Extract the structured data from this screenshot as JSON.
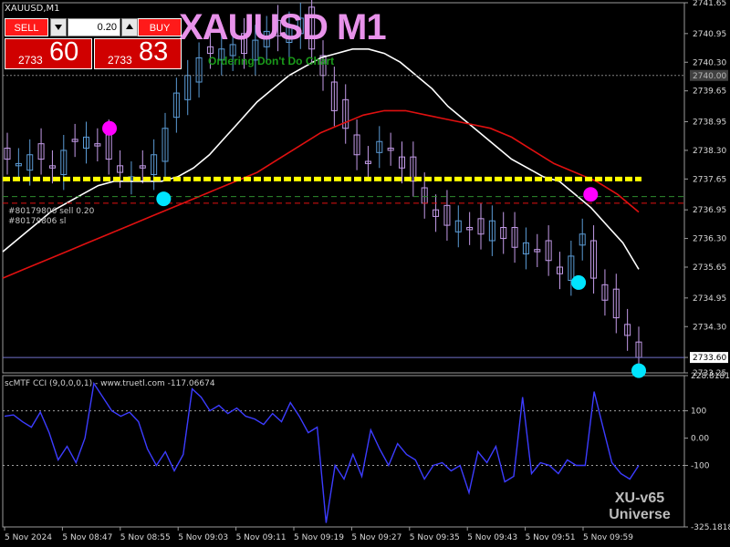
{
  "chart": {
    "symbol_title": "XAUUSD,M1",
    "watermark": "XAUUSD M1",
    "watermark_sub": "Ordering Don't Do Chart",
    "order_labels": [
      "#80179806 sell 0.20",
      "#80179806 sl"
    ],
    "indicator_title": "scMTF CCI (9,0,0,0,1) - www.truetl.com -117.06674",
    "brand_line1": "XU-v65",
    "brand_line2": "Universe"
  },
  "trade_panel": {
    "sell_label": "SELL",
    "buy_label": "BUY",
    "lot_value": "0.20",
    "sell_price_small": "2733",
    "sell_price_big": "60",
    "buy_price_small": "2733",
    "buy_price_big": "83"
  },
  "colors": {
    "background": "#000000",
    "bull_candle": "#5b9bd5",
    "bear_candle": "#c39be8",
    "ma_fast": "#ffffff",
    "ma_slow": "#e01010",
    "support_line": "#ffff00",
    "cci_line": "#3c3cff",
    "marker_buy": "#00e5ff",
    "marker_sell": "#ff00ff",
    "stop_line": "#e01010",
    "order_line": "#2e8b2e",
    "grid_dot": "#808080"
  },
  "chart_data": [
    {
      "type": "candlestick",
      "title": "XAUUSD,M1",
      "ylim": [
        2733.25,
        2741.65
      ],
      "y_ticks": [
        "2741.65",
        "2740.95",
        "2740.30",
        "2739.65",
        "2738.95",
        "2738.30",
        "2737.65",
        "2736.95",
        "2736.30",
        "2735.65",
        "2734.95",
        "2734.30",
        "2733.60",
        "2733.25"
      ],
      "price_labels": {
        "bid": "2733.60",
        "level": "2740.00"
      },
      "x_ticks": [
        "5 Nov 2024",
        "5 Nov 08:47",
        "5 Nov 08:55",
        "5 Nov 09:03",
        "5 Nov 09:11",
        "5 Nov 09:19",
        "5 Nov 09:27",
        "5 Nov 09:35",
        "5 Nov 09:43",
        "5 Nov 09:51",
        "5 Nov 09:59"
      ],
      "levels": {
        "support": 2737.65,
        "order": 2737.25,
        "stop": 2737.1,
        "bid": 2733.6,
        "top_dotted": 2740.0
      },
      "series": {
        "close_trend": [
          2738.1,
          2738.0,
          2738.2,
          2738.1,
          2737.9,
          2738.3,
          2738.5,
          2738.6,
          2738.4,
          2738.1,
          2737.8,
          2737.7,
          2737.9,
          2738.2,
          2738.8,
          2739.6,
          2740.0,
          2740.4,
          2740.5,
          2740.6,
          2740.7,
          2740.5,
          2740.8,
          2741.0,
          2740.9,
          2741.1,
          2741.3,
          2740.6,
          2740.0,
          2739.2,
          2738.8,
          2738.2,
          2738.0,
          2738.5,
          2738.3,
          2737.9,
          2737.6,
          2737.1,
          2736.8,
          2736.6,
          2736.7,
          2736.5,
          2736.4,
          2736.7,
          2736.3,
          2736.1,
          2736.2,
          2736.0,
          2735.8,
          2735.5,
          2735.9,
          2736.4,
          2735.4,
          2734.9,
          2734.5,
          2734.1,
          2733.6
        ],
        "ma_fast": [
          2736.0,
          2736.3,
          2736.6,
          2736.9,
          2737.1,
          2737.3,
          2737.5,
          2737.6,
          2737.6,
          2737.6,
          2737.6,
          2737.7,
          2737.9,
          2738.2,
          2738.6,
          2739.0,
          2739.4,
          2739.7,
          2740.0,
          2740.2,
          2740.4,
          2740.5,
          2740.6,
          2740.6,
          2740.5,
          2740.3,
          2740.0,
          2739.7,
          2739.3,
          2739.0,
          2738.7,
          2738.4,
          2738.1,
          2737.9,
          2737.7,
          2737.6,
          2737.3,
          2737.0,
          2736.6,
          2736.2,
          2735.6
        ],
        "ma_slow": [
          2735.4,
          2735.6,
          2735.8,
          2736.0,
          2736.2,
          2736.4,
          2736.6,
          2736.8,
          2737.0,
          2737.2,
          2737.4,
          2737.6,
          2737.8,
          2738.1,
          2738.4,
          2738.7,
          2738.9,
          2739.1,
          2739.2,
          2739.2,
          2739.1,
          2739.0,
          2738.9,
          2738.8,
          2738.6,
          2738.3,
          2738.0,
          2737.8,
          2737.6,
          2737.3,
          2736.9
        ],
        "markers_sell": [
          [
            2738.8,
            17
          ],
          [
            2737.3,
            97
          ]
        ],
        "markers_buy": [
          [
            2737.2,
            26
          ],
          [
            2735.3,
            95
          ],
          [
            2733.3,
            105
          ]
        ]
      }
    },
    {
      "type": "line",
      "title": "scMTF CCI (9,0,0,0,1) - www.truetl.com -117.06674",
      "ylim": [
        -325.18183,
        228.81818
      ],
      "y_ticks": [
        "228.81818",
        "100",
        "0.00",
        "-100",
        "-325.18183"
      ],
      "levels": [
        100,
        -100
      ],
      "values": [
        80,
        85,
        60,
        40,
        95,
        20,
        -80,
        -30,
        -90,
        0,
        200,
        150,
        100,
        80,
        95,
        60,
        -40,
        -100,
        -50,
        -120,
        -60,
        180,
        150,
        100,
        120,
        90,
        110,
        80,
        70,
        50,
        90,
        60,
        130,
        80,
        20,
        40,
        -310,
        -100,
        -150,
        -60,
        -140,
        30,
        -40,
        -100,
        -20,
        -60,
        -80,
        -150,
        -100,
        -90,
        -120,
        -100,
        -200,
        -50,
        -90,
        -30,
        -160,
        -140,
        150,
        -130,
        -90,
        -100,
        -130,
        -80,
        -100,
        -100,
        170,
        40,
        -90,
        -130,
        -150,
        -100
      ]
    }
  ]
}
